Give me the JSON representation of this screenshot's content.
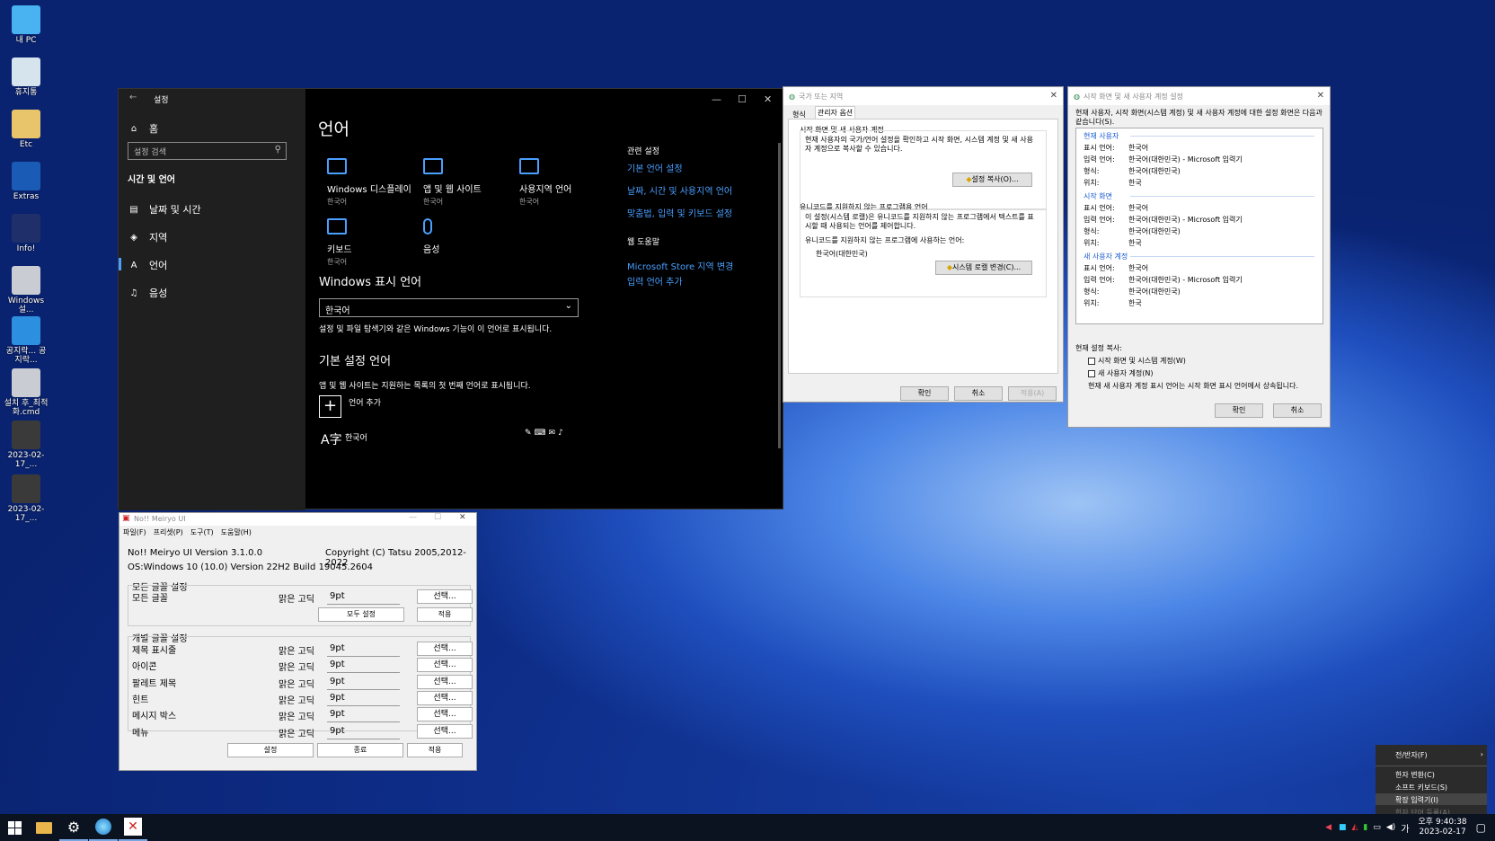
{
  "desktop": {
    "icons": [
      {
        "label": "내 PC",
        "color": "#49b2f0"
      },
      {
        "label": "휴지통",
        "color": "#d6e4ee"
      },
      {
        "label": "Etc",
        "color": "#e8c56a"
      },
      {
        "label": "Extras",
        "color": "#1a5bb5"
      },
      {
        "label": "Info!",
        "color": "#1e2f6a"
      },
      {
        "label": "Windows 설...",
        "color": "#c9ccd2"
      },
      {
        "label": "공지락... 공지락...",
        "color": "#2d8fe0"
      },
      {
        "label": "설치 후_최적화.cmd",
        "color": "#c9ccd2"
      },
      {
        "label": "2023-02-17_...",
        "color": "#3a3a3a"
      },
      {
        "label": "2023-02-17_...",
        "color": "#3a3a3a"
      }
    ]
  },
  "settings": {
    "title": "설정",
    "home": "홈",
    "search_placeholder": "설정 검색",
    "section": "시간 및 언어",
    "nav": [
      {
        "label": "날짜 및 시간",
        "icon": "calendar-icon"
      },
      {
        "label": "지역",
        "icon": "globe-icon"
      },
      {
        "label": "언어",
        "icon": "language-icon"
      },
      {
        "label": "음성",
        "icon": "microphone-icon"
      }
    ],
    "heading": "언어",
    "tiles": [
      {
        "label": "Windows 디스플레이",
        "sub": "한국어"
      },
      {
        "label": "앱 및 웹 사이트",
        "sub": "한국어"
      },
      {
        "label": "사용지역 언어",
        "sub": "한국어"
      },
      {
        "label": "키보드",
        "sub": "한국어"
      },
      {
        "label": "음성",
        "sub": ""
      }
    ],
    "display_lang_heading": "Windows 표시 언어",
    "display_lang_value": "한국어",
    "display_lang_desc": "설정 및 파일 탐색기와 같은 Windows 기능이 이 언어로 표시됩니다.",
    "pref_heading": "기본 설정 언어",
    "pref_desc": "앱 및 웹 사이트는 지원하는 목록의 첫 번째 언어로 표시됩니다.",
    "add_lang": "언어 추가",
    "lang_item": "한국어",
    "related": {
      "heading": "관련 설정",
      "links": [
        "기본 언어 설정",
        "날짜, 시간 및 사용지역 언어",
        "맞춤법, 입력 및 키보드 설정"
      ]
    },
    "web_help": {
      "heading": "웹 도움말",
      "links": [
        "Microsoft Store 지역 변경",
        "입력 언어 추가"
      ]
    }
  },
  "region": {
    "title": "국가 또는 지역",
    "tabs": [
      "형식",
      "관리자 옵션"
    ],
    "welcome_group": "시작 화면 및 새 사용자 계정",
    "welcome_desc": "현재 사용자의 국가/언어 설정을 확인하고 시작 화면, 시스템 계정 및 새 사용자 계정으로 복사할 수 있습니다.",
    "copy_btn": "설정 복사(O)...",
    "unicode_group": "유니코드를 지원하지 않는 프로그램용 언어",
    "unicode_desc": "이 설정(시스템 로캘)은 유니코드를 지원하지 않는 프로그램에서 텍스트를 표시할 때 사용되는 언어를 제어합니다.",
    "unicode_label": "유니코드를 지원하지 않는 프로그램에 사용하는 언어:",
    "unicode_value": "한국어(대한민국)",
    "locale_btn": "시스템 로캘 변경(C)...",
    "ok": "확인",
    "cancel": "취소",
    "apply": "적용(A)"
  },
  "welcome": {
    "title": "시작 화면 및 새 사용자 계정 설정",
    "desc": "현재 사용자, 시작 화면(시스템 계정) 및 새 사용자 계정에 대한 설정 화면은 다음과 같습니다(S).",
    "sections": [
      {
        "name": "현재 사용자",
        "rows": [
          [
            "표시 언어:",
            "한국어"
          ],
          [
            "입력 언어:",
            "한국어(대한민국) - Microsoft 입력기"
          ],
          [
            "형식:",
            "한국어(대한민국)"
          ],
          [
            "위치:",
            "한국"
          ]
        ]
      },
      {
        "name": "시작 화면",
        "rows": [
          [
            "표시 언어:",
            "한국어"
          ],
          [
            "입력 언어:",
            "한국어(대한민국) - Microsoft 입력기"
          ],
          [
            "형식:",
            "한국어(대한민국)"
          ],
          [
            "위치:",
            "한국"
          ]
        ]
      },
      {
        "name": "새 사용자 계정",
        "rows": [
          [
            "표시 언어:",
            "한국어"
          ],
          [
            "입력 언어:",
            "한국어(대한민국) - Microsoft 입력기"
          ],
          [
            "형식:",
            "한국어(대한민국)"
          ],
          [
            "위치:",
            "한국"
          ]
        ]
      }
    ],
    "copy_label": "현재 설정 복사:",
    "chk1": "시작 화면 및 시스템 계정(W)",
    "chk2": "새 사용자 계정(N)",
    "note": "현재 새 사용자 계정 표시 언어는 시작 화면 표시 언어에서 상속됩니다.",
    "ok": "확인",
    "cancel": "취소"
  },
  "meiryo": {
    "title": "No!! Meiryo UI",
    "menu": [
      "파일(F)",
      "프리셋(P)",
      "도구(T)",
      "도움말(H)"
    ],
    "version": "No!! Meiryo UI Version 3.1.0.0",
    "copyright": "Copyright (C) Tatsu 2005,2012-2022",
    "os": "OS:Windows 10 (10.0) Version 22H2 Build 19045.2604",
    "all_group": "모든 글꼴 설정",
    "all_row": {
      "label": "모든 글꼴",
      "font": "맑은 고딕",
      "size": "9pt",
      "select": "선택..."
    },
    "all_set": "모두 설정",
    "apply_small": "적용",
    "indiv_group": "개별 글꼴 설정",
    "rows": [
      {
        "label": "제목 표시줄",
        "font": "맑은 고딕",
        "size": "9pt",
        "select": "선택..."
      },
      {
        "label": "아이콘",
        "font": "맑은 고딕",
        "size": "9pt",
        "select": "선택..."
      },
      {
        "label": "팔레트 제목",
        "font": "맑은 고딕",
        "size": "9pt",
        "select": "선택..."
      },
      {
        "label": "힌트",
        "font": "맑은 고딕",
        "size": "9pt",
        "select": "선택..."
      },
      {
        "label": "메시지 박스",
        "font": "맑은 고딕",
        "size": "9pt",
        "select": "선택..."
      },
      {
        "label": "메뉴",
        "font": "맑은 고딕",
        "size": "9pt",
        "select": "선택..."
      }
    ],
    "set": "설정",
    "exit": "종료",
    "apply": "적용"
  },
  "ime_menu": {
    "items": [
      "전/반자(F)",
      "한자 변환(C)",
      "소프트 키보드(S)",
      "확장 입력기(I)",
      "한자 단어 등록(A)"
    ]
  },
  "tray": {
    "ime": "가",
    "time": "오후 9:40:38",
    "date": "2023-02-17"
  }
}
